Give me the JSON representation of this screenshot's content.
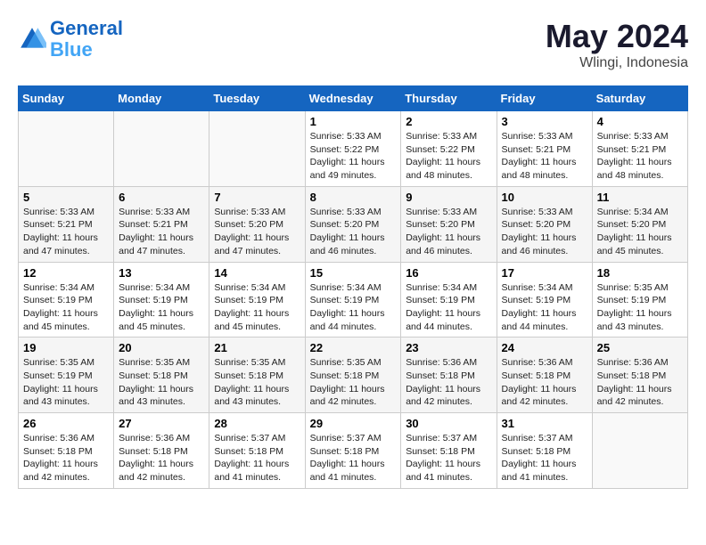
{
  "header": {
    "logo_line1": "General",
    "logo_line2": "Blue",
    "month": "May 2024",
    "location": "Wlingi, Indonesia"
  },
  "weekdays": [
    "Sunday",
    "Monday",
    "Tuesday",
    "Wednesday",
    "Thursday",
    "Friday",
    "Saturday"
  ],
  "weeks": [
    [
      {
        "day": "",
        "info": ""
      },
      {
        "day": "",
        "info": ""
      },
      {
        "day": "",
        "info": ""
      },
      {
        "day": "1",
        "info": "Sunrise: 5:33 AM\nSunset: 5:22 PM\nDaylight: 11 hours\nand 49 minutes."
      },
      {
        "day": "2",
        "info": "Sunrise: 5:33 AM\nSunset: 5:22 PM\nDaylight: 11 hours\nand 48 minutes."
      },
      {
        "day": "3",
        "info": "Sunrise: 5:33 AM\nSunset: 5:21 PM\nDaylight: 11 hours\nand 48 minutes."
      },
      {
        "day": "4",
        "info": "Sunrise: 5:33 AM\nSunset: 5:21 PM\nDaylight: 11 hours\nand 48 minutes."
      }
    ],
    [
      {
        "day": "5",
        "info": "Sunrise: 5:33 AM\nSunset: 5:21 PM\nDaylight: 11 hours\nand 47 minutes."
      },
      {
        "day": "6",
        "info": "Sunrise: 5:33 AM\nSunset: 5:21 PM\nDaylight: 11 hours\nand 47 minutes."
      },
      {
        "day": "7",
        "info": "Sunrise: 5:33 AM\nSunset: 5:20 PM\nDaylight: 11 hours\nand 47 minutes."
      },
      {
        "day": "8",
        "info": "Sunrise: 5:33 AM\nSunset: 5:20 PM\nDaylight: 11 hours\nand 46 minutes."
      },
      {
        "day": "9",
        "info": "Sunrise: 5:33 AM\nSunset: 5:20 PM\nDaylight: 11 hours\nand 46 minutes."
      },
      {
        "day": "10",
        "info": "Sunrise: 5:33 AM\nSunset: 5:20 PM\nDaylight: 11 hours\nand 46 minutes."
      },
      {
        "day": "11",
        "info": "Sunrise: 5:34 AM\nSunset: 5:20 PM\nDaylight: 11 hours\nand 45 minutes."
      }
    ],
    [
      {
        "day": "12",
        "info": "Sunrise: 5:34 AM\nSunset: 5:19 PM\nDaylight: 11 hours\nand 45 minutes."
      },
      {
        "day": "13",
        "info": "Sunrise: 5:34 AM\nSunset: 5:19 PM\nDaylight: 11 hours\nand 45 minutes."
      },
      {
        "day": "14",
        "info": "Sunrise: 5:34 AM\nSunset: 5:19 PM\nDaylight: 11 hours\nand 45 minutes."
      },
      {
        "day": "15",
        "info": "Sunrise: 5:34 AM\nSunset: 5:19 PM\nDaylight: 11 hours\nand 44 minutes."
      },
      {
        "day": "16",
        "info": "Sunrise: 5:34 AM\nSunset: 5:19 PM\nDaylight: 11 hours\nand 44 minutes."
      },
      {
        "day": "17",
        "info": "Sunrise: 5:34 AM\nSunset: 5:19 PM\nDaylight: 11 hours\nand 44 minutes."
      },
      {
        "day": "18",
        "info": "Sunrise: 5:35 AM\nSunset: 5:19 PM\nDaylight: 11 hours\nand 43 minutes."
      }
    ],
    [
      {
        "day": "19",
        "info": "Sunrise: 5:35 AM\nSunset: 5:19 PM\nDaylight: 11 hours\nand 43 minutes."
      },
      {
        "day": "20",
        "info": "Sunrise: 5:35 AM\nSunset: 5:18 PM\nDaylight: 11 hours\nand 43 minutes."
      },
      {
        "day": "21",
        "info": "Sunrise: 5:35 AM\nSunset: 5:18 PM\nDaylight: 11 hours\nand 43 minutes."
      },
      {
        "day": "22",
        "info": "Sunrise: 5:35 AM\nSunset: 5:18 PM\nDaylight: 11 hours\nand 42 minutes."
      },
      {
        "day": "23",
        "info": "Sunrise: 5:36 AM\nSunset: 5:18 PM\nDaylight: 11 hours\nand 42 minutes."
      },
      {
        "day": "24",
        "info": "Sunrise: 5:36 AM\nSunset: 5:18 PM\nDaylight: 11 hours\nand 42 minutes."
      },
      {
        "day": "25",
        "info": "Sunrise: 5:36 AM\nSunset: 5:18 PM\nDaylight: 11 hours\nand 42 minutes."
      }
    ],
    [
      {
        "day": "26",
        "info": "Sunrise: 5:36 AM\nSunset: 5:18 PM\nDaylight: 11 hours\nand 42 minutes."
      },
      {
        "day": "27",
        "info": "Sunrise: 5:36 AM\nSunset: 5:18 PM\nDaylight: 11 hours\nand 42 minutes."
      },
      {
        "day": "28",
        "info": "Sunrise: 5:37 AM\nSunset: 5:18 PM\nDaylight: 11 hours\nand 41 minutes."
      },
      {
        "day": "29",
        "info": "Sunrise: 5:37 AM\nSunset: 5:18 PM\nDaylight: 11 hours\nand 41 minutes."
      },
      {
        "day": "30",
        "info": "Sunrise: 5:37 AM\nSunset: 5:18 PM\nDaylight: 11 hours\nand 41 minutes."
      },
      {
        "day": "31",
        "info": "Sunrise: 5:37 AM\nSunset: 5:18 PM\nDaylight: 11 hours\nand 41 minutes."
      },
      {
        "day": "",
        "info": ""
      }
    ]
  ]
}
